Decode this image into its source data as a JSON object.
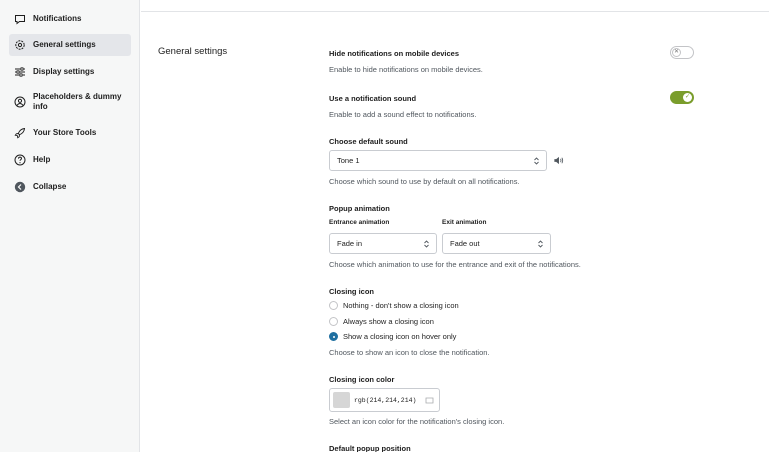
{
  "sidebar": {
    "items": [
      {
        "label": "Notifications",
        "icon": "chat-bubble-icon",
        "active": false
      },
      {
        "label": "General settings",
        "icon": "gear-icon",
        "active": true
      },
      {
        "label": "Display settings",
        "icon": "sliders-icon",
        "active": false
      },
      {
        "label": "Placeholders & dummy info",
        "icon": "user-circle-icon",
        "active": false
      },
      {
        "label": "Your Store Tools",
        "icon": "rocket-icon",
        "active": false
      },
      {
        "label": "Help",
        "icon": "help-icon",
        "active": false
      },
      {
        "label": "Collapse",
        "icon": "collapse-arrow-icon",
        "active": false
      }
    ]
  },
  "main": {
    "section_title": "General settings",
    "hide_mobile": {
      "label": "Hide notifications on mobile devices",
      "help": "Enable to hide notifications on mobile devices.",
      "enabled": false
    },
    "sound": {
      "label": "Use a notification sound",
      "help": "Enable to add a sound effect to notifications.",
      "enabled": true
    },
    "default_sound": {
      "label": "Choose default sound",
      "value": "Tone 1",
      "help": "Choose which sound to use by default on all notifications.",
      "play_icon": "speaker-icon"
    },
    "popup_animation": {
      "label": "Popup animation",
      "entrance_label": "Entrance animation",
      "entrance_value": "Fade in",
      "exit_label": "Exit animation",
      "exit_value": "Fade out",
      "help": "Choose which animation to use for the entrance and exit of the notifications."
    },
    "closing_icon": {
      "label": "Closing icon",
      "options": [
        {
          "label": "Nothing - don't show a closing icon",
          "checked": false
        },
        {
          "label": "Always show a closing icon",
          "checked": false
        },
        {
          "label": "Show a closing icon on hover only",
          "checked": true
        }
      ],
      "help": "Choose to show an icon to close the notification."
    },
    "closing_icon_color": {
      "label": "Closing icon color",
      "value": "rgb(214,214,214)",
      "swatch_color": "#d6d6d6",
      "help": "Select an icon color for the notification's closing icon."
    },
    "default_position": {
      "label": "Default popup position"
    }
  },
  "colors": {
    "toggle_on": "#7a9d2c",
    "radio_checked": "#1f6fa0",
    "sidebar_bg": "#f6f7f7",
    "sidebar_active": "#e4e6ea"
  }
}
